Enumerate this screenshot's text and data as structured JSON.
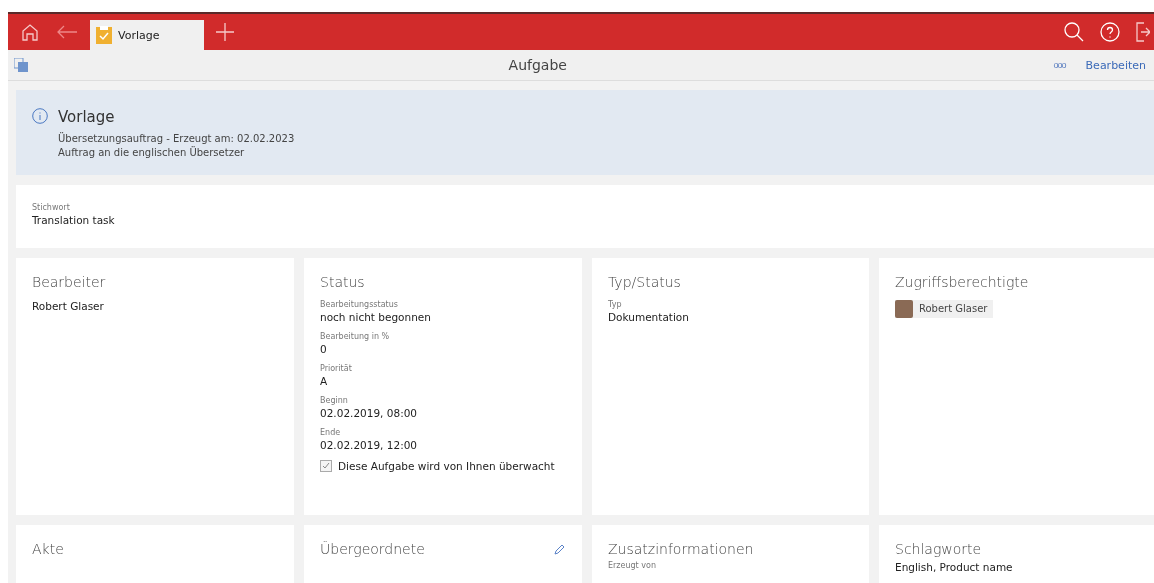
{
  "tabs": [
    {
      "label": "Vorlage",
      "selected": true
    }
  ],
  "toolbar": {
    "title": "Aufgabe",
    "more": "ooo",
    "edit": "Bearbeiten"
  },
  "info": {
    "title": "Vorlage",
    "lines": [
      "Übersetzungsauftrag - Erzeugt am: 02.02.2023",
      "Auftrag an die englischen Übersetzer"
    ]
  },
  "keyword": {
    "label": "Stichwort",
    "value": "Translation task"
  },
  "cards": [
    {
      "kind": "text",
      "title": "Bearbeiter",
      "value": "Robert Glaser"
    },
    {
      "kind": "fields",
      "title": "Status",
      "fields": [
        {
          "label": "Bearbeitungsstatus",
          "value": "noch nicht begonnen"
        },
        {
          "label": "Bearbeitung in %",
          "value": "0"
        },
        {
          "label": "Priorität",
          "value": "A"
        },
        {
          "label": "Beginn",
          "value": "02.02.2019, 08:00"
        },
        {
          "label": "Ende",
          "value": "02.02.2019, 12:00"
        }
      ],
      "checkbox": {
        "label": "Diese Aufgabe wird von Ihnen überwacht",
        "checked": true
      }
    },
    {
      "kind": "fields",
      "title": "Typ/Status",
      "fields": [
        {
          "label": "Typ",
          "value": "Dokumentation"
        }
      ]
    },
    {
      "kind": "people",
      "title": "Zugriffsberechtigte",
      "people": [
        "Robert Glaser"
      ]
    }
  ],
  "bottom_cards": [
    {
      "title": "Akte",
      "editable": false
    },
    {
      "title": "Übergeordnete",
      "editable": true
    },
    {
      "title": "Zusatzinformationen",
      "editable": false,
      "label": "Erzeugt von"
    },
    {
      "title": "Schlagworte",
      "editable": false,
      "value": "English, Product name"
    }
  ]
}
